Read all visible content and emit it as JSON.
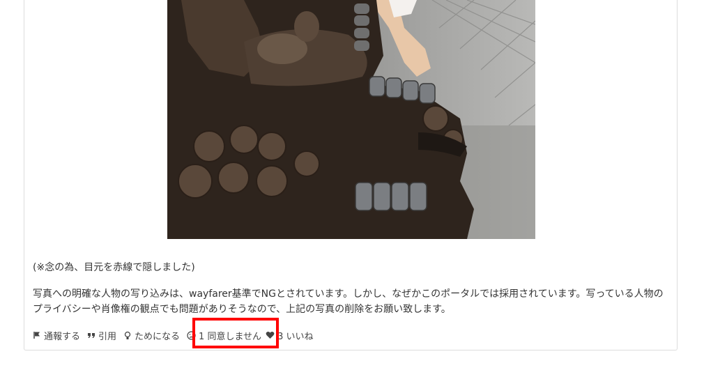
{
  "post": {
    "note": "(※念の為、目元を赤線で隠しました)",
    "body": "写真への明確な人物の写り込みは、wayfarer基準でNGとされています。しかし、なぜかこのポータルでは採用されています。写っている人物のプライバシーや肖像権の観点でも問題がありそうなので、上記の写真の削除をお願い致します。"
  },
  "actions": {
    "report": {
      "label": "通報する",
      "icon": "flag-icon"
    },
    "quote": {
      "label": "引用",
      "icon": "quote-icon"
    },
    "helpful": {
      "label": "ためになる",
      "icon": "lightbulb-icon"
    },
    "disagree": {
      "label": "1 同意しません",
      "icon": "frown-icon"
    },
    "like": {
      "label": "3 いいね",
      "icon": "heart-icon"
    }
  },
  "colors": {
    "highlight": "#ff0000",
    "text": "#333333",
    "border": "#dcdcdc"
  }
}
